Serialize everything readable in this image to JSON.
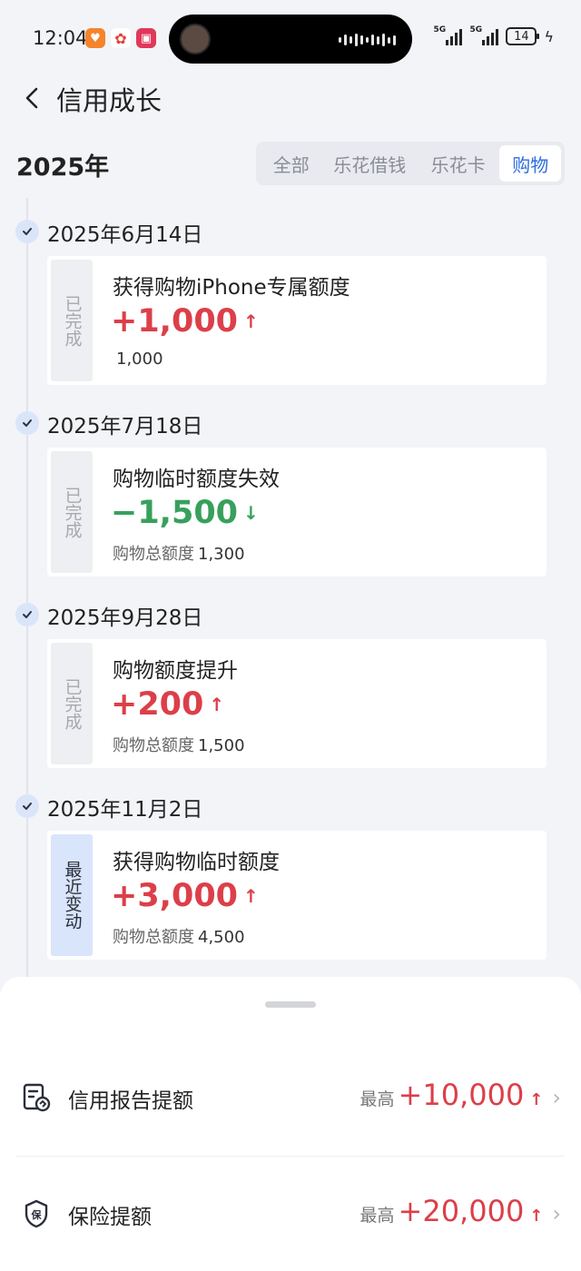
{
  "status_bar": {
    "time": "12:04",
    "app_icons": [
      "taobao-icon",
      "colorful-app-icon",
      "game-app-icon"
    ],
    "signal_labels": [
      "5G",
      "5G"
    ],
    "battery": "14"
  },
  "header": {
    "title": "信用成长"
  },
  "year": "2025年",
  "filters": [
    {
      "label": "全部",
      "active": false
    },
    {
      "label": "乐花借钱",
      "active": false
    },
    {
      "label": "乐花卡",
      "active": false
    },
    {
      "label": "购物",
      "active": true
    }
  ],
  "timeline": [
    {
      "date": "2025年6月14日",
      "badge": "已完成",
      "title": "获得购物iPhone专属额度",
      "amount": "+1,000",
      "direction": "up",
      "sub_label": "",
      "sub_value": "1,000"
    },
    {
      "date": "2025年7月18日",
      "badge": "已完成",
      "title": "购物临时额度失效",
      "amount": "−1,500",
      "direction": "down",
      "sub_label": "购物总额度",
      "sub_value": "1,300"
    },
    {
      "date": "2025年9月28日",
      "badge": "已完成",
      "title": "购物额度提升",
      "amount": "+200",
      "direction": "up",
      "sub_label": "购物总额度",
      "sub_value": "1,500"
    },
    {
      "date": "2025年11月2日",
      "badge": "最近变动",
      "title": "获得购物临时额度",
      "amount": "+3,000",
      "direction": "up",
      "sub_label": "购物总额度",
      "sub_value": "4,500"
    }
  ],
  "bottom_sheet": {
    "rows": [
      {
        "icon": "credit-report-icon",
        "label": "信用报告提额",
        "prefix": "最高",
        "value": "+10,000"
      },
      {
        "icon": "insurance-shield-icon",
        "label": "保险提额",
        "prefix": "最高",
        "value": "+20,000"
      }
    ]
  },
  "colors": {
    "increase": "#dc3f49",
    "decrease": "#37a05c",
    "active_tab": "#2f6de0",
    "recent_badge": "#d9e5fb"
  }
}
